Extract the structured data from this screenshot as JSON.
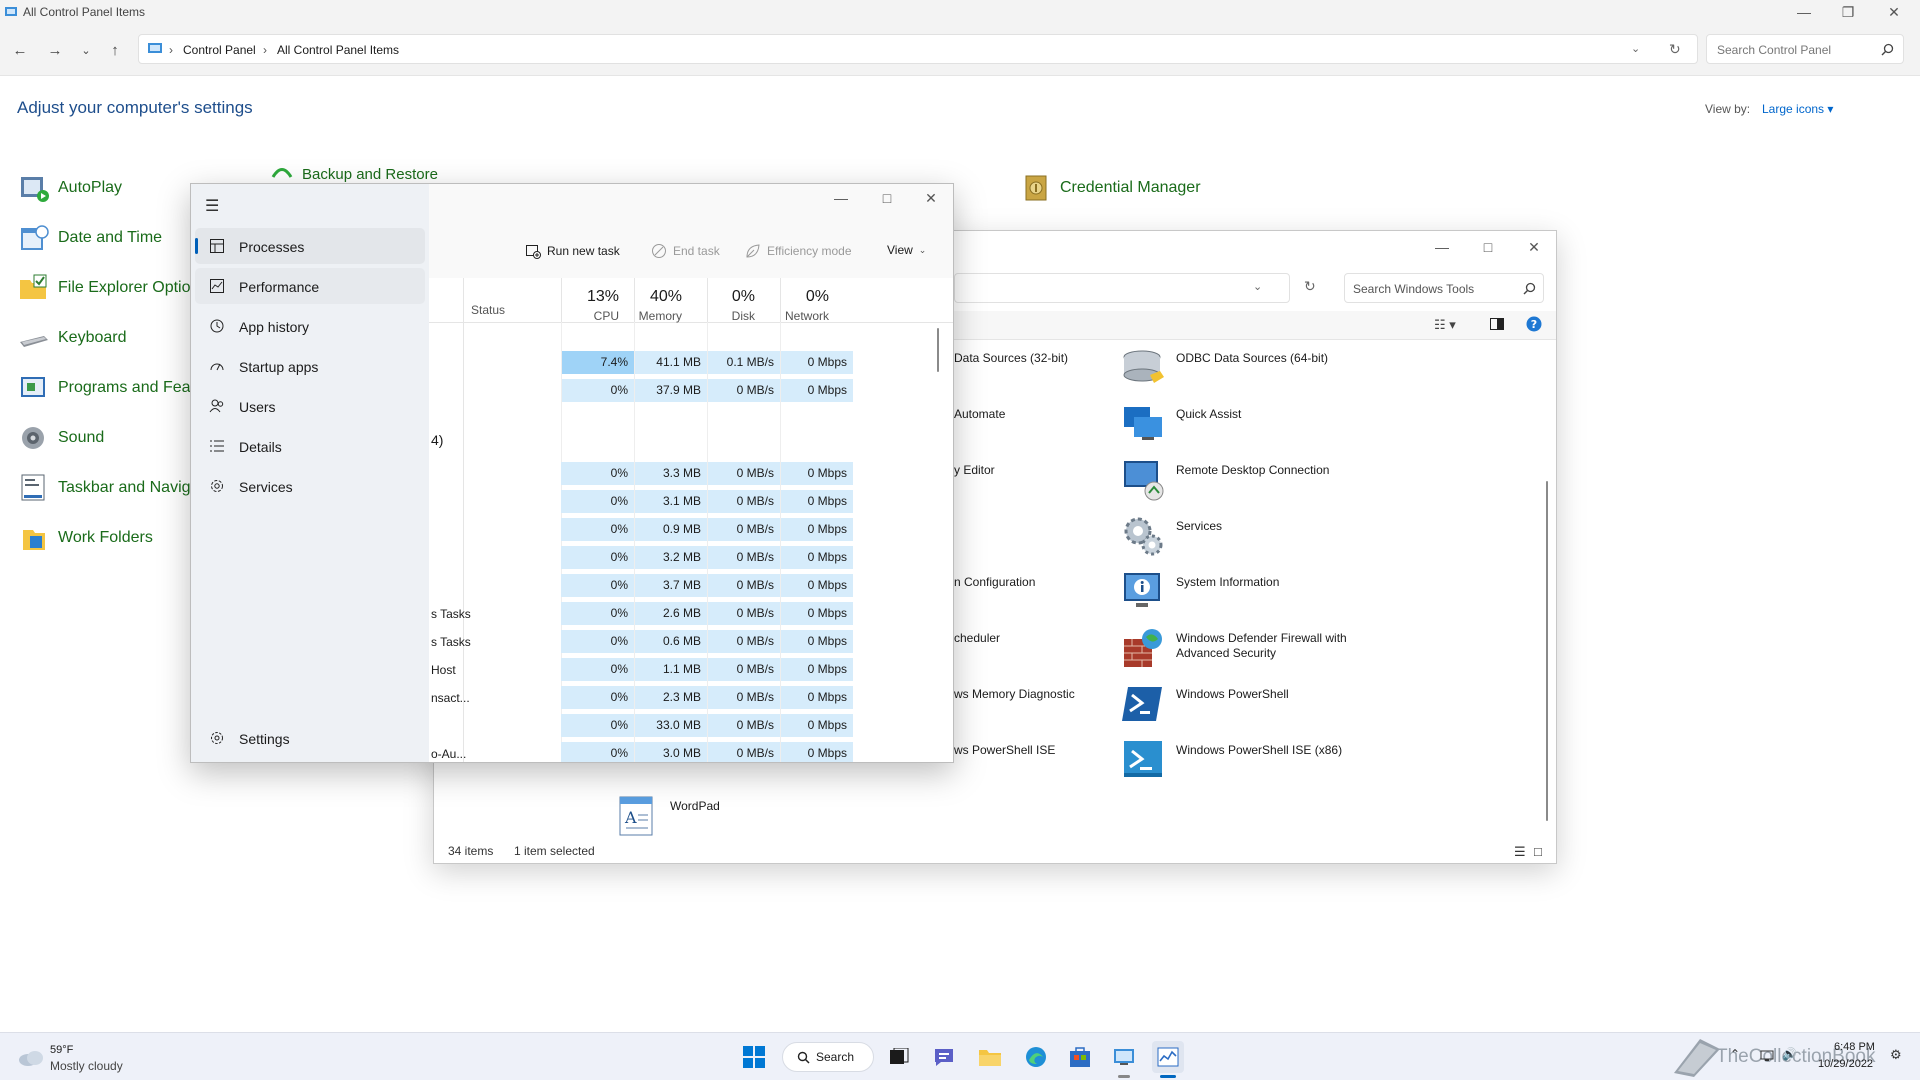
{
  "control_panel": {
    "window_title": "All Control Panel Items",
    "breadcrumb": [
      "Control Panel",
      "All Control Panel Items"
    ],
    "search_placeholder": "Search Control Panel",
    "heading": "Adjust your computer's settings",
    "view_by_label": "View by:",
    "view_by_value": "Large icons",
    "items": [
      {
        "label": "AutoPlay"
      },
      {
        "label": "Date and Time"
      },
      {
        "label": "File Explorer Optio"
      },
      {
        "label": "Keyboard"
      },
      {
        "label": "Programs and Feat"
      },
      {
        "label": "Sound"
      },
      {
        "label": "Taskbar and Navig"
      },
      {
        "label": "Work Folders"
      },
      {
        "label": "Backup and Restore"
      },
      {
        "label": "Credential Manager"
      }
    ]
  },
  "windows_tools": {
    "search_placeholder": "Search Windows Tools",
    "clipped_labels": [
      "Data Sources (32-bit)",
      "Automate",
      "y Editor",
      "n Configuration",
      "cheduler",
      "ws Memory Diagnostic",
      "ws PowerShell ISE"
    ],
    "items": [
      {
        "label": "ODBC Data Sources (64-bit)"
      },
      {
        "label": "Quick Assist"
      },
      {
        "label": "Remote Desktop Connection"
      },
      {
        "label": "Services"
      },
      {
        "label": "System Information"
      },
      {
        "label": "Windows Defender Firewall with Advanced Security"
      },
      {
        "label": "Windows PowerShell"
      },
      {
        "label": "Windows PowerShell ISE (x86)"
      },
      {
        "label": "WordPad"
      }
    ],
    "status": {
      "count": "34 items",
      "selected": "1 item selected"
    }
  },
  "task_manager": {
    "nav": [
      {
        "label": "Processes"
      },
      {
        "label": "Performance"
      },
      {
        "label": "App history"
      },
      {
        "label": "Startup apps"
      },
      {
        "label": "Users"
      },
      {
        "label": "Details"
      },
      {
        "label": "Services"
      }
    ],
    "settings_label": "Settings",
    "toolbar": {
      "run_new_task": "Run new task",
      "end_task": "End task",
      "efficiency_mode": "Efficiency mode",
      "view": "View"
    },
    "columns": {
      "status": "Status",
      "cpu": {
        "pct": "13%",
        "name": "CPU"
      },
      "memory": {
        "pct": "40%",
        "name": "Memory"
      },
      "disk": {
        "pct": "0%",
        "name": "Disk"
      },
      "network": {
        "pct": "0%",
        "name": "Network"
      }
    },
    "group_label": "4)",
    "rows": [
      {
        "name": "",
        "cpu": "7.4%",
        "mem": "41.1 MB",
        "disk": "0.1 MB/s",
        "net": "0 Mbps"
      },
      {
        "name": "",
        "cpu": "0%",
        "mem": "37.9 MB",
        "disk": "0 MB/s",
        "net": "0 Mbps"
      },
      {
        "name": "",
        "cpu": "",
        "mem": "",
        "disk": "",
        "net": ""
      },
      {
        "name": "",
        "cpu": "0%",
        "mem": "3.3 MB",
        "disk": "0 MB/s",
        "net": "0 Mbps"
      },
      {
        "name": "",
        "cpu": "0%",
        "mem": "3.1 MB",
        "disk": "0 MB/s",
        "net": "0 Mbps"
      },
      {
        "name": "",
        "cpu": "0%",
        "mem": "0.9 MB",
        "disk": "0 MB/s",
        "net": "0 Mbps"
      },
      {
        "name": "",
        "cpu": "0%",
        "mem": "3.2 MB",
        "disk": "0 MB/s",
        "net": "0 Mbps"
      },
      {
        "name": "",
        "cpu": "0%",
        "mem": "3.7 MB",
        "disk": "0 MB/s",
        "net": "0 Mbps"
      },
      {
        "name": "s Tasks",
        "cpu": "0%",
        "mem": "2.6 MB",
        "disk": "0 MB/s",
        "net": "0 Mbps"
      },
      {
        "name": "s Tasks",
        "cpu": "0%",
        "mem": "0.6 MB",
        "disk": "0 MB/s",
        "net": "0 Mbps"
      },
      {
        "name": " Host",
        "cpu": "0%",
        "mem": "1.1 MB",
        "disk": "0 MB/s",
        "net": "0 Mbps"
      },
      {
        "name": "nsact...",
        "cpu": "0%",
        "mem": "2.3 MB",
        "disk": "0 MB/s",
        "net": "0 Mbps"
      },
      {
        "name": "",
        "cpu": "0%",
        "mem": "33.0 MB",
        "disk": "0 MB/s",
        "net": "0 Mbps"
      },
      {
        "name": "o-Au...",
        "cpu": "0%",
        "mem": "3.0 MB",
        "disk": "0 MB/s",
        "net": "0 Mbps"
      }
    ]
  },
  "taskbar": {
    "weather_temp": "59°F",
    "weather_desc": "Mostly cloudy",
    "search_label": "Search",
    "time": "6:48 PM",
    "date": "10/29/2022",
    "watermark": "TheCollectionBook"
  },
  "colors": {
    "accent": "#005fb8",
    "cpu_highlight": "#9fd3f7",
    "heat_light": "#d6ecfb",
    "cp_link": "#1a6b1a"
  }
}
